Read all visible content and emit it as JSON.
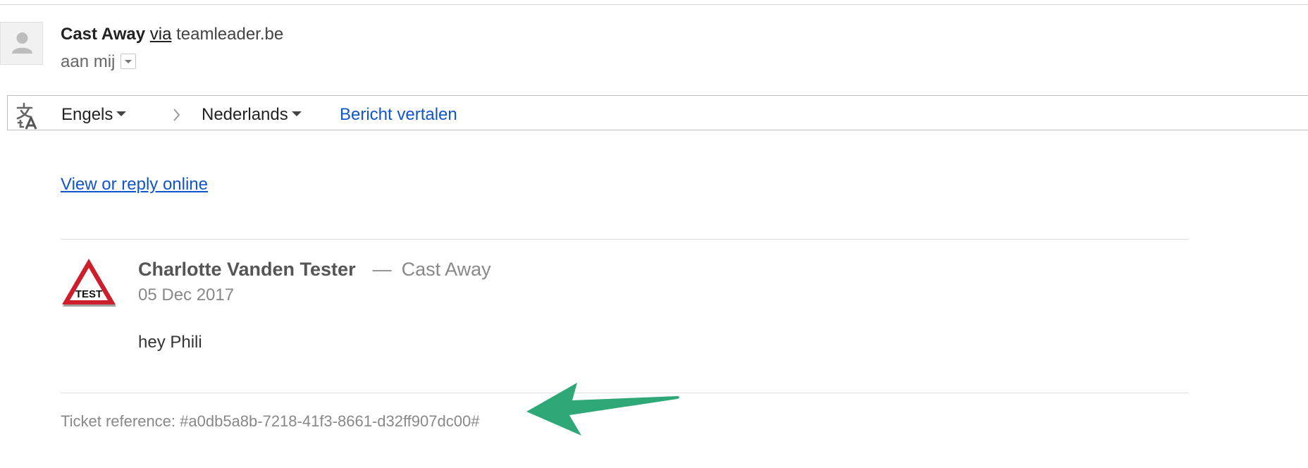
{
  "sender": {
    "name": "Cast Away",
    "via_label": "via",
    "domain": "teamleader.be",
    "recipient_text": "aan mij"
  },
  "translate_bar": {
    "source_language": "Engels",
    "target_language": "Nederlands",
    "translate_action": "Bericht vertalen",
    "icon": "translate-icon"
  },
  "body": {
    "view_online_link": "View or reply online",
    "message": {
      "author": "Charlotte Vanden Tester",
      "separator": "—",
      "company": "Cast Away",
      "date": "05 Dec 2017",
      "text": "hey Phili",
      "logo_text": "TEST"
    },
    "ticket_reference": "Ticket reference: #a0db5a8b-7218-41f3-8661-d32ff907dc00#"
  },
  "colors": {
    "link": "#1155cc",
    "annotation_arrow": "#2fa877",
    "logo_red": "#cc1f2b"
  }
}
